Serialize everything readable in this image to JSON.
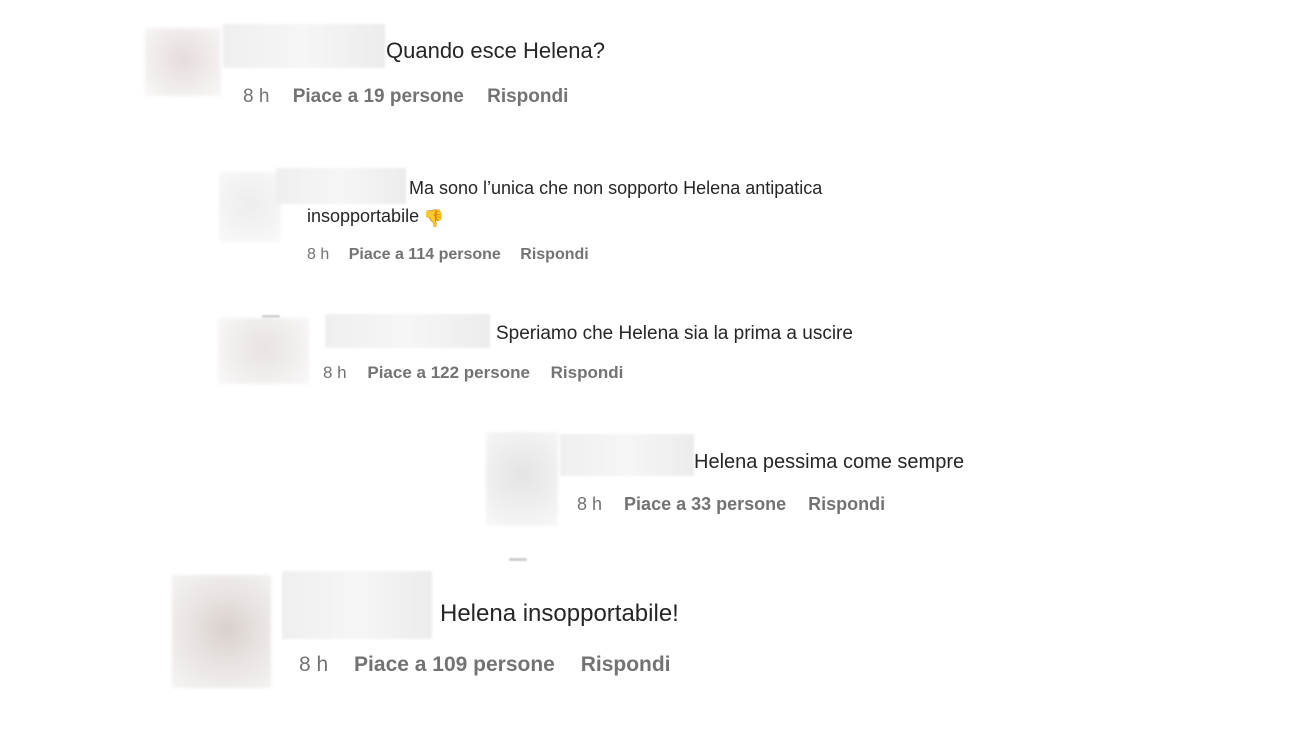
{
  "comments": [
    {
      "text": "Quando esce Helena?",
      "time": "8 h",
      "likes": "Piace a 19 persone",
      "reply": "Rispondi"
    },
    {
      "text": "Ma sono l’unica che non sopporto Helena antipatica",
      "text_line2": "insopportabile",
      "emoji_icon": "thumbs-down-icon",
      "time": "8 h",
      "likes": "Piace a 114 persone",
      "reply": "Rispondi"
    },
    {
      "text": "Speriamo che Helena sia la prima a uscire",
      "time": "8 h",
      "likes": "Piace a 122 persone",
      "reply": "Rispondi"
    },
    {
      "text": "Helena pessima come sempre",
      "time": "8 h",
      "likes": "Piace a 33 persone",
      "reply": "Rispondi"
    },
    {
      "text": "Helena insopportabile!",
      "time": "8 h",
      "likes": "Piace a 109 persone",
      "reply": "Rispondi"
    }
  ]
}
